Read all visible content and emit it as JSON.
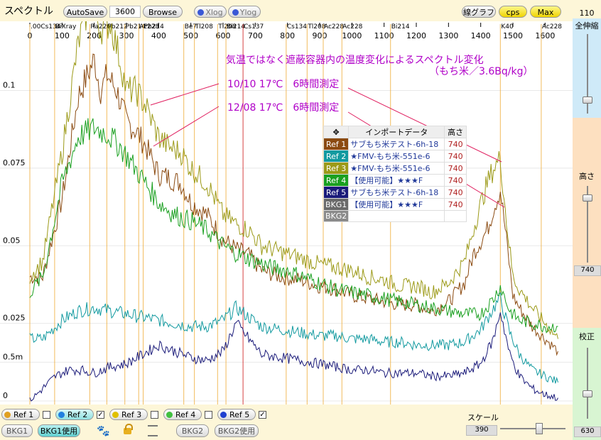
{
  "toolbar": {
    "title": "スペクトル",
    "autosave_label": "AutoSave",
    "time_value": "3600",
    "browse_label": "Browse",
    "xlog_label": "Xlog",
    "ylog_label": "Ylog",
    "line_graph_label": "線グラフ",
    "cps_label": "cps",
    "max_label": "Max"
  },
  "right_panel": {
    "top_value": "110",
    "zoom_all_label": "全伸縮",
    "height_label": "高さ",
    "height_value": "740",
    "calib_label": "校正",
    "calib_value": "630",
    "colors": {
      "blue": "#cfeaf8",
      "orange": "#fde0c0",
      "green": "#d8f5d2"
    }
  },
  "annotations": {
    "heading1": "気温ではなく遮蔽容器内の温度変化によるスペクトル変化",
    "heading2": "（もち米／3.6Bq/kg）",
    "label1": "10/10 17℃　6時間測定",
    "label2": "12/08 17℃　6時間測定"
  },
  "legend": {
    "header_name": "インポートデータ",
    "header_height": "高さ",
    "rows": [
      {
        "tag": "Ref 1",
        "name": "サブもち米テスト-6h-18",
        "height": "740",
        "color": "#8b4a10"
      },
      {
        "tag": "Ref 2",
        "name": "★FMV-もち米-551e-6",
        "height": "740",
        "color": "#139aa0"
      },
      {
        "tag": "Ref 3",
        "name": "★FMV-もち米-551e-6",
        "height": "740",
        "color": "#9c9a18"
      },
      {
        "tag": "Ref 4",
        "name": "【使用可能】★★★F",
        "height": "740",
        "color": "#1aa020"
      },
      {
        "tag": "Ref 5",
        "name": "サブもち米テスト-6h-18",
        "height": "740",
        "color": "#1b1b7a"
      },
      {
        "tag": "BKG1",
        "name": "【使用可能】★★★F",
        "height": "740",
        "color": "#6a6a6a"
      },
      {
        "tag": "BKG2",
        "name": "",
        "height": "",
        "color": "#8a8a8a"
      }
    ]
  },
  "bottom": {
    "refs": [
      {
        "label": "Ref 1",
        "checked": "",
        "color": "#e0a020"
      },
      {
        "label": "Ref 2",
        "checked": "✓",
        "color": "#2080e0"
      },
      {
        "label": "Ref 3",
        "checked": "",
        "color": "#e0c000"
      },
      {
        "label": "Ref 4",
        "checked": "",
        "color": "#40c040"
      },
      {
        "label": "Ref 5",
        "checked": "✓",
        "color": "#2040d0"
      }
    ],
    "bkg1_label": "BKG1",
    "bkg1_use_label": "BKG1使用",
    "bkg2_label": "BKG2",
    "bkg2_use_label": "BKG2使用",
    "scale_label": "スケール",
    "scale_value": "390"
  },
  "chart_data": {
    "type": "line",
    "x_ticks": [
      0,
      100,
      200,
      300,
      400,
      500,
      600,
      700,
      800,
      900,
      1000,
      1100,
      1200,
      1300,
      1400,
      1500,
      1600
    ],
    "xlim": [
      0,
      1650
    ],
    "y_ticks": [
      {
        "label": "0",
        "value": 0
      },
      {
        "label": "0.5m",
        "value": 0.0125
      },
      {
        "label": "0.025",
        "value": 0.025
      },
      {
        "label": "0.05",
        "value": 0.05
      },
      {
        "label": "0.075",
        "value": 0.075
      },
      {
        "label": "0.1",
        "value": 0.1
      }
    ],
    "ylim": [
      0,
      0.12
    ],
    "nuclide_markers": [
      {
        "label": ".00Cs134",
        "x": 0
      },
      {
        "label": "BiXray",
        "x": 77
      },
      {
        "label": "Ra226",
        "x": 186
      },
      {
        "label": "Pb212",
        "x": 239
      },
      {
        "label": "Pb214",
        "x": 295
      },
      {
        "label": "Ac228",
        "x": 338
      },
      {
        "label": "Pb214",
        "x": 352
      },
      {
        "label": "Be7",
        "x": 478
      },
      {
        "label": "Tl208",
        "x": 511
      },
      {
        "label": "Tl208",
        "x": 583
      },
      {
        "label": "Bi214",
        "x": 609
      },
      {
        "label": "Cs137",
        "x": 662
      },
      {
        "label": "Cs134",
        "x": 796
      },
      {
        "label": "Tl208",
        "x": 861
      },
      {
        "label": "Ac228",
        "x": 911
      },
      {
        "label": "Ac228",
        "x": 969
      },
      {
        "label": "Bi214",
        "x": 1120
      },
      {
        "label": "K40",
        "x": 1461
      },
      {
        "label": "Ac228",
        "x": 1588
      }
    ],
    "series": [
      {
        "name": "Ref 1",
        "color": "#8b4a10",
        "x": [
          0,
          40,
          100,
          150,
          200,
          220,
          240,
          270,
          300,
          330,
          360,
          400,
          430,
          470,
          500,
          550,
          600,
          640,
          680,
          720,
          780,
          840,
          900,
          950,
          1000,
          1050,
          1100,
          1150,
          1200,
          1250,
          1300,
          1350,
          1380,
          1420,
          1440,
          1461,
          1480,
          1500,
          1520,
          1560,
          1600,
          1640
        ],
        "y": [
          0.04,
          0.04,
          0.065,
          0.098,
          0.11,
          0.1,
          0.105,
          0.1,
          0.09,
          0.087,
          0.082,
          0.073,
          0.072,
          0.07,
          0.064,
          0.06,
          0.052,
          0.049,
          0.047,
          0.042,
          0.04,
          0.039,
          0.037,
          0.036,
          0.034,
          0.033,
          0.032,
          0.031,
          0.031,
          0.029,
          0.032,
          0.038,
          0.048,
          0.055,
          0.062,
          0.068,
          0.052,
          0.034,
          0.03,
          0.024,
          0.02,
          0.016
        ]
      },
      {
        "name": "Ref 2",
        "color": "#139aa0",
        "x": [
          0,
          40,
          100,
          150,
          200,
          250,
          300,
          350,
          400,
          450,
          500,
          550,
          600,
          640,
          680,
          720,
          780,
          840,
          900,
          950,
          1000,
          1050,
          1100,
          1150,
          1200,
          1250,
          1300,
          1350,
          1400,
          1440,
          1461,
          1490,
          1520,
          1560,
          1600,
          1640
        ],
        "y": [
          0.02,
          0.02,
          0.026,
          0.029,
          0.03,
          0.029,
          0.028,
          0.027,
          0.026,
          0.025,
          0.024,
          0.024,
          0.026,
          0.03,
          0.027,
          0.024,
          0.023,
          0.022,
          0.021,
          0.021,
          0.02,
          0.02,
          0.019,
          0.019,
          0.018,
          0.018,
          0.018,
          0.019,
          0.023,
          0.03,
          0.033,
          0.022,
          0.015,
          0.01,
          0.008,
          0.006
        ]
      },
      {
        "name": "Ref 3",
        "color": "#9c9a18",
        "x": [
          0,
          40,
          100,
          150,
          190,
          220,
          250,
          280,
          300,
          330,
          360,
          400,
          430,
          470,
          500,
          550,
          600,
          640,
          680,
          720,
          780,
          840,
          900,
          950,
          1000,
          1050,
          1100,
          1150,
          1200,
          1250,
          1300,
          1350,
          1390,
          1420,
          1440,
          1461,
          1480,
          1500,
          1520,
          1560,
          1600,
          1640
        ],
        "y": [
          0.04,
          0.045,
          0.08,
          0.115,
          0.13,
          0.12,
          0.122,
          0.11,
          0.1,
          0.1,
          0.095,
          0.085,
          0.082,
          0.08,
          0.075,
          0.07,
          0.06,
          0.057,
          0.055,
          0.05,
          0.048,
          0.046,
          0.044,
          0.043,
          0.042,
          0.04,
          0.039,
          0.037,
          0.037,
          0.035,
          0.038,
          0.045,
          0.06,
          0.07,
          0.075,
          0.078,
          0.058,
          0.04,
          0.036,
          0.03,
          0.025,
          0.02
        ]
      },
      {
        "name": "Ref 4",
        "color": "#1aa020",
        "x": [
          0,
          40,
          100,
          150,
          200,
          240,
          280,
          320,
          360,
          400,
          450,
          500,
          550,
          600,
          650,
          700,
          750,
          800,
          850,
          900,
          950,
          1000,
          1050,
          1100,
          1150,
          1200,
          1250,
          1300,
          1350,
          1400,
          1440,
          1461,
          1490,
          1520,
          1560,
          1600,
          1640
        ],
        "y": [
          0.035,
          0.04,
          0.07,
          0.085,
          0.088,
          0.086,
          0.082,
          0.076,
          0.07,
          0.064,
          0.06,
          0.058,
          0.055,
          0.05,
          0.047,
          0.045,
          0.043,
          0.042,
          0.04,
          0.038,
          0.036,
          0.035,
          0.034,
          0.033,
          0.032,
          0.031,
          0.03,
          0.029,
          0.028,
          0.028,
          0.033,
          0.037,
          0.029,
          0.026,
          0.025,
          0.024,
          0.024
        ]
      },
      {
        "name": "Ref 5",
        "color": "#1b1b7a",
        "x": [
          0,
          40,
          80,
          120,
          160,
          200,
          250,
          300,
          350,
          400,
          450,
          500,
          550,
          600,
          640,
          680,
          720,
          780,
          840,
          900,
          950,
          1000,
          1050,
          1100,
          1150,
          1200,
          1250,
          1300,
          1350,
          1400,
          1440,
          1461,
          1490,
          1520,
          1560,
          1600,
          1640
        ],
        "y": [
          0.0,
          0.004,
          0.008,
          0.01,
          0.01,
          0.009,
          0.011,
          0.012,
          0.015,
          0.018,
          0.016,
          0.014,
          0.013,
          0.016,
          0.025,
          0.02,
          0.015,
          0.014,
          0.013,
          0.012,
          0.011,
          0.01,
          0.01,
          0.009,
          0.009,
          0.009,
          0.008,
          0.008,
          0.009,
          0.012,
          0.02,
          0.029,
          0.015,
          0.008,
          0.004,
          0.002,
          0.001
        ]
      }
    ]
  }
}
